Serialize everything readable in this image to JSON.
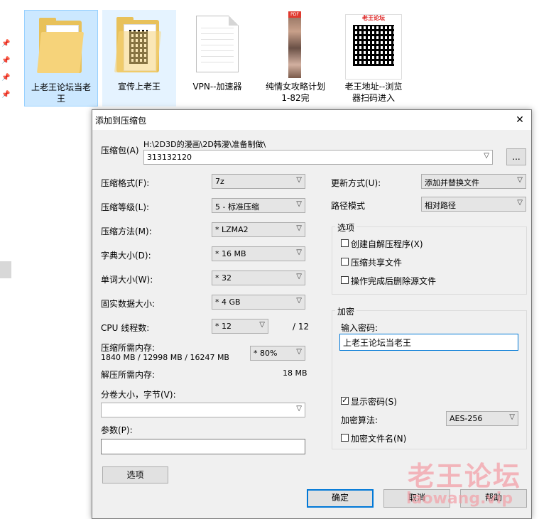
{
  "explorer": {
    "files": [
      {
        "name": "上老王论坛当老王",
        "line1": "上老王论坛当老",
        "line2": "王"
      },
      {
        "name": "宣传上老王",
        "line1": "宣传上老王",
        "line2": ""
      },
      {
        "name": "VPN--加速器",
        "line1": "VPN--加速器",
        "line2": ""
      },
      {
        "name": "纯情女攻略计划1-82完",
        "line1": "纯情女攻略计划",
        "line2": "1-82完"
      },
      {
        "name": "老王地址--浏览器扫码进入",
        "line1": "老王地址--浏览",
        "line2": "器扫码进入"
      }
    ],
    "pdf_badge": "PDF",
    "qr_header": "老王论坛"
  },
  "dialog": {
    "title": "添加到压缩包",
    "archive_label": "压缩包(A)",
    "archive_path": "H:\\2D3D的漫画\\2D韩漫\\准备制做\\",
    "archive_name": "313132120",
    "browse_label": "...",
    "format_label": "压缩格式(F):",
    "format_value": "7z",
    "level_label": "压缩等级(L):",
    "level_value": "5 - 标准压缩",
    "method_label": "压缩方法(M):",
    "method_value": "* LZMA2",
    "dict_label": "字典大小(D):",
    "dict_value": "* 16 MB",
    "word_label": "单词大小(W):",
    "word_value": "* 32",
    "solid_label": "固实数据大小:",
    "solid_value": "* 4 GB",
    "threads_label": "CPU 线程数:",
    "threads_value": "* 12",
    "threads_total": "/ 12",
    "mem_label": "压缩所需内存:",
    "mem_detail": "1840 MB / 12998 MB / 16247 MB",
    "mem_value": "* 80%",
    "decomp_label": "解压所需内存:",
    "decomp_value": "18 MB",
    "split_label": "分卷大小，字节(V):",
    "split_value": "",
    "params_label": "参数(P):",
    "params_value": "",
    "options_button": "选项",
    "update_label": "更新方式(U):",
    "update_value": "添加并替换文件",
    "path_label": "路径模式",
    "path_value": "相对路径",
    "options_group": "选项",
    "opt_sfx": "创建自解压程序(X)",
    "opt_shared": "压缩共享文件",
    "opt_delete": "操作完成后删除源文件",
    "enc_group": "加密",
    "pwd_label": "输入密码:",
    "pwd_value": "上老王论坛当老王",
    "show_pwd": "显示密码(S)",
    "enc_method_label": "加密算法:",
    "enc_method_value": "AES-256",
    "enc_names": "加密文件名(N)",
    "ok": "确定",
    "cancel": "取消",
    "help": "帮助"
  },
  "watermark": {
    "line1": "老王论坛",
    "line2": "laowang.vip"
  }
}
